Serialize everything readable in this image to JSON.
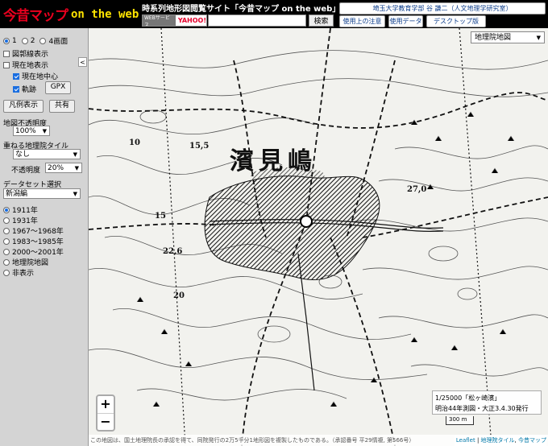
{
  "header": {
    "logo_main": "今昔マップ",
    "logo_sub": "on the web",
    "site_title": "時系列地形図閲覧サイト「今昔マップ on the web」",
    "search_provider": {
      "label1": "WEBサービス",
      "label2": "YAHOO!"
    },
    "search_placeholder": "",
    "search_button": "検索",
    "author": "埼玉大学教育学部 谷 謙二（人文地理学研究室）",
    "links": [
      "使用上の注意",
      "使用データ",
      "デスクトップ版"
    ]
  },
  "sidebar": {
    "screen_modes": [
      {
        "label": "1",
        "selected": true
      },
      {
        "label": "2",
        "selected": false
      },
      {
        "label": "4画面",
        "selected": false
      }
    ],
    "checkboxes": [
      {
        "label": "図郭線表示",
        "checked": false
      },
      {
        "label": "現在地表示",
        "checked": false
      },
      {
        "label": "現在地中心",
        "checked": true
      },
      {
        "label": "軌跡",
        "checked": true
      }
    ],
    "gpx_button": "GPX",
    "legend_button": "凡例表示",
    "share_button": "共有",
    "opacity_label": "地図不透明度",
    "opacity_value": "100%",
    "overlay_label": "重ねる地理院タイル",
    "overlay_value": "なし",
    "overlay_opacity_label": "不透明度",
    "overlay_opacity_value": "20%",
    "dataset_label": "データセット選択",
    "dataset_value": "新潟編",
    "periods": [
      {
        "label": "1911年",
        "selected": true
      },
      {
        "label": "1931年",
        "selected": false
      },
      {
        "label": "1967～1968年",
        "selected": false
      },
      {
        "label": "1983～1985年",
        "selected": false
      },
      {
        "label": "2000～2001年",
        "selected": false
      },
      {
        "label": "地理院地図",
        "selected": false
      },
      {
        "label": "非表示",
        "selected": false
      }
    ]
  },
  "map": {
    "map_type": "地理院地図",
    "place_name": "濱見嶋",
    "elevation_labels": [
      "15,5",
      "10",
      "15",
      "22,6",
      "20",
      "27,0"
    ],
    "zoom_in": "+",
    "zoom_out": "−",
    "info_line1": "1/25000「松ヶ崎濱」",
    "info_line2": "明治44年測図・大正3.4.30発行",
    "scale_label": "300 m",
    "attribution_note": "この地図は、国土地理院長の承認を得て、同院発行の2万5千分1地形図を複製したものである。（承認番号 平29情複, 第566号）",
    "attribution_links": [
      "Leaflet",
      "地理院タイル",
      "今昔マップ"
    ]
  }
}
